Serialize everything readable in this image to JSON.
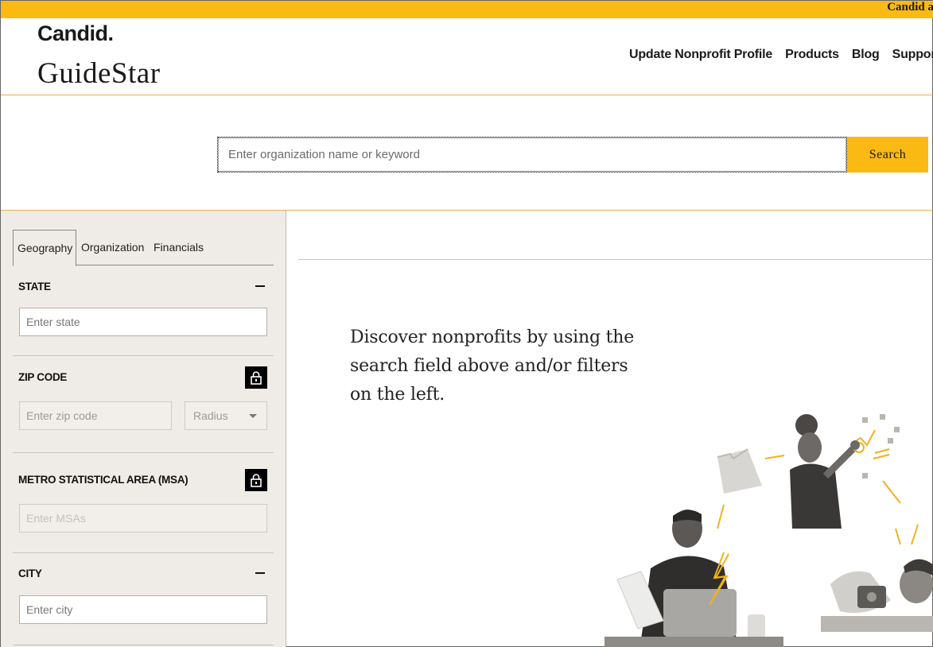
{
  "top_strip": {
    "text": "Candid a"
  },
  "header": {
    "brand_candid": "Candid.",
    "brand_guidestar": "GuideStar",
    "nav": [
      "Update Nonprofit Profile",
      "Products",
      "Blog",
      "Suppor"
    ]
  },
  "search": {
    "placeholder": "Enter organization name or keyword",
    "button_label": "Search"
  },
  "sidebar": {
    "tabs": [
      "Geography",
      "Organization",
      "Financials"
    ],
    "active_tab": "Geography",
    "sections": {
      "state": {
        "title": "STATE",
        "placeholder": "Enter state"
      },
      "zip": {
        "title": "ZIP CODE",
        "placeholder": "Enter zip code",
        "radius_label": "Radius"
      },
      "msa": {
        "title": "METRO STATISTICAL AREA (MSA)",
        "placeholder": "Enter MSAs"
      },
      "city": {
        "title": "CITY",
        "placeholder": "Enter city"
      }
    }
  },
  "main": {
    "discover_text": "Discover nonprofits by using the search field above and/or filters on the left."
  },
  "colors": {
    "accent": "#fbb913",
    "rule": "#e7b24a",
    "sidebar_bg": "#efebe6"
  },
  "icons": [
    "lock-icon",
    "collapse-icon",
    "chevron-down-icon",
    "lightning-icon"
  ]
}
